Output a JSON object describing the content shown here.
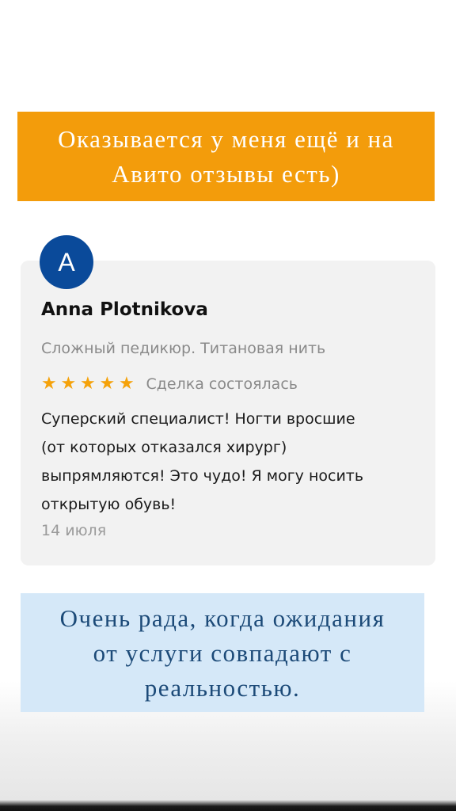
{
  "top_banner": {
    "line1": "Оказывается у меня ещё и на",
    "line2": "Авито отзывы есть)",
    "background": "#f39c0b"
  },
  "review": {
    "avatar_letter": "A",
    "avatar_color": "#0a4a9a",
    "name": "Anna Plotnikova",
    "service": "Сложный педикюр. Титановая нить",
    "rating": 5,
    "rating_max": 5,
    "stars": [
      "★",
      "★",
      "★",
      "★",
      "★"
    ],
    "star_color": "#f5a20a",
    "deal_status": "Сделка состоялась",
    "text_lines": [
      "Суперский специалист! Ногти вросшие",
      "(от которых отказался хирург)",
      "выпрямляются! Это чудо! Я могу носить",
      "открытую обувь!"
    ],
    "date": "14 июля"
  },
  "bottom_banner": {
    "line1": "Очень рада, когда ожидания",
    "line2": "от услуги совпадают с",
    "line3": "реальностью.",
    "background": "#d5e8f8"
  }
}
